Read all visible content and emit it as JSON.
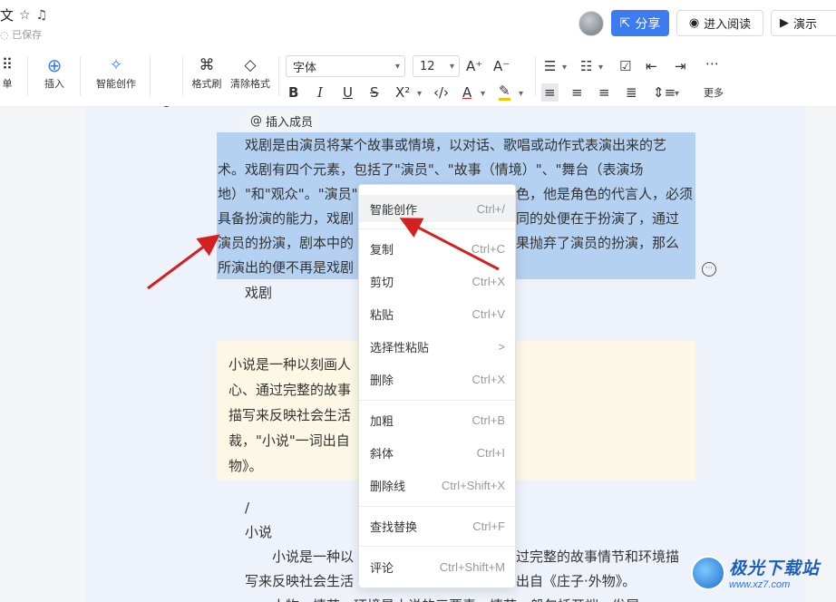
{
  "header": {
    "title": "文",
    "saved": "已保存",
    "share": "分享",
    "read": "进入阅读",
    "present": "演示"
  },
  "toolbar": {
    "menu_label": "单",
    "insert_label": "插入",
    "ai_label": "智能创作",
    "format_painter": "格式刷",
    "clear_format": "清除格式",
    "font": "字体",
    "font_size": "12",
    "more": "更多"
  },
  "doc": {
    "mention": "插入成员",
    "p1_l1": "戏剧是由演员将某个故事或情境，以对话、歌唱或动作式表演出来的艺",
    "p1_l2": "术。戏剧有四个元素，包括了\"演员\"、\"故事（情境）\"、\"舞台（表演场",
    "p1_l3a": "地）\"和\"观众\"。\"演员\"",
    "p1_l3b": "色，他是角色的代言人，必须",
    "p1_l4a": "具备扮演的能力，戏剧",
    "p1_l4b": "同的处便在于扮演了，通过",
    "p1_l5a": "演员的扮演，剧本中的",
    "p1_l5b": "果抛弃了演员的扮演，那么",
    "p1_l6": "所演出的便不再是戏剧",
    "xiju": "戏剧",
    "callout_l1": "小说是一种以刻画人",
    "callout_l2": "心、通过完整的故事",
    "callout_l3": "描写来反映社会生活",
    "callout_l4": "裁，\"小说\"一词出自",
    "callout_l5": "物》。",
    "slash": "/",
    "xiaoshuo": "小说",
    "p2_l1a": "小说是一种以",
    "p2_l1b": "过完整的故事情节和环境描",
    "p2_l2a": "写来反映社会生活",
    "p2_l2b": "出自《庄子·外物》。",
    "p2_l3": "人物、情节、环境是小说的三要素。情节一般包括开端、发展"
  },
  "context_menu": {
    "items": [
      {
        "label": "智能创作",
        "shortcut": "Ctrl+/"
      },
      {
        "label": "复制",
        "shortcut": "Ctrl+C"
      },
      {
        "label": "剪切",
        "shortcut": "Ctrl+X"
      },
      {
        "label": "粘贴",
        "shortcut": "Ctrl+V"
      },
      {
        "label": "选择性粘贴",
        "shortcut": ">"
      },
      {
        "label": "删除",
        "shortcut": "Ctrl+X"
      },
      {
        "label": "加粗",
        "shortcut": "Ctrl+B"
      },
      {
        "label": "斜体",
        "shortcut": "Ctrl+I"
      },
      {
        "label": "删除线",
        "shortcut": "Ctrl+Shift+X"
      },
      {
        "label": "查找替换",
        "shortcut": "Ctrl+F"
      },
      {
        "label": "评论",
        "shortcut": "Ctrl+Shift+M"
      }
    ]
  },
  "watermark": {
    "main": "极光下载站",
    "sub": "www.xz7.com"
  },
  "colors": {
    "accent": "#3d7cf0",
    "selection": "#b5d1f1",
    "arrow": "#d42020"
  }
}
